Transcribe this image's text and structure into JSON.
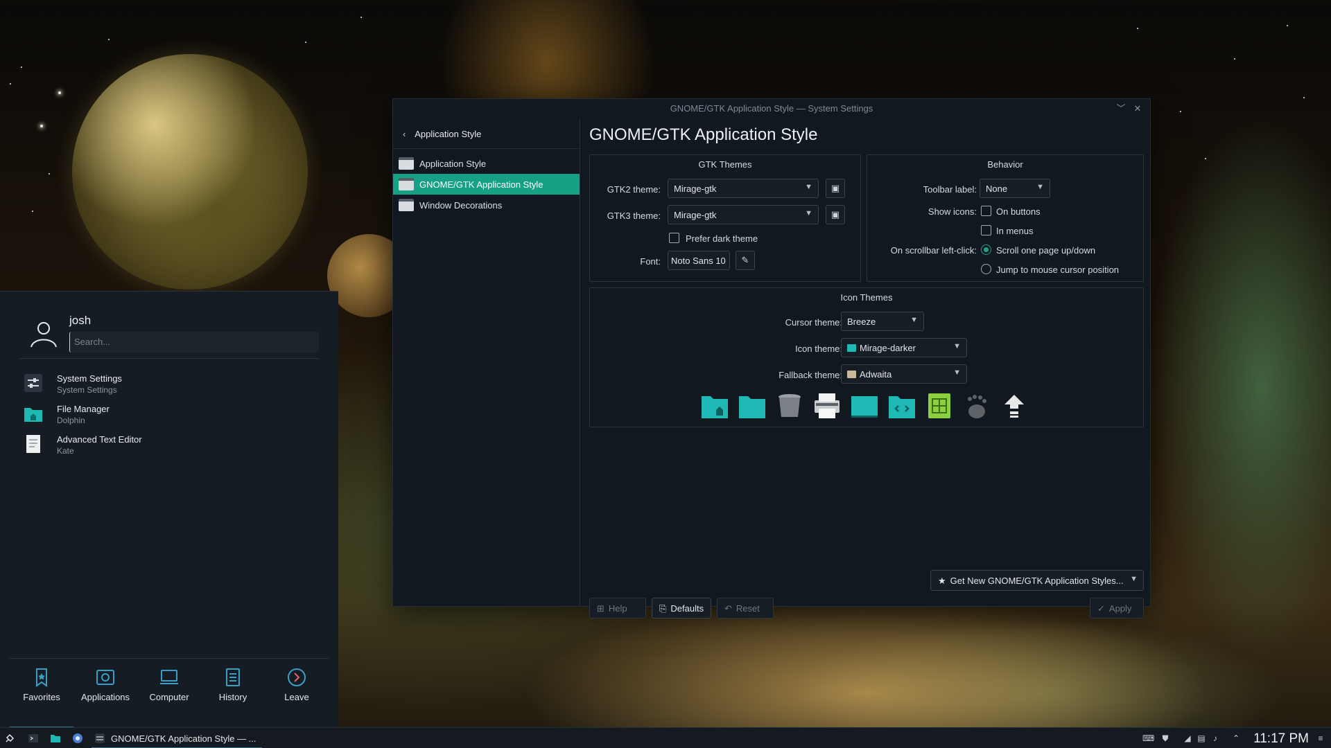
{
  "launcher": {
    "user_name": "josh",
    "search_placeholder": "Search...",
    "favorites": [
      {
        "name": "System Settings",
        "desc": "System Settings",
        "icon": "settings-icon"
      },
      {
        "name": "File Manager",
        "desc": "Dolphin",
        "icon": "folder-icon"
      },
      {
        "name": "Advanced Text Editor",
        "desc": "Kate",
        "icon": "text-editor-icon"
      }
    ],
    "tabs": [
      {
        "label": "Favorites",
        "icon": "bookmark-icon"
      },
      {
        "label": "Applications",
        "icon": "applications-icon"
      },
      {
        "label": "Computer",
        "icon": "computer-icon"
      },
      {
        "label": "History",
        "icon": "history-icon"
      },
      {
        "label": "Leave",
        "icon": "leave-icon"
      }
    ]
  },
  "window": {
    "title": "GNOME/GTK Application Style — System Settings",
    "sidebar": {
      "back_label": "Application Style",
      "items": [
        {
          "label": "Application Style"
        },
        {
          "label": "GNOME/GTK Application Style"
        },
        {
          "label": "Window Decorations"
        }
      ]
    },
    "page_title": "GNOME/GTK Application Style",
    "gtk_themes": {
      "title": "GTK Themes",
      "gtk2_label": "GTK2 theme:",
      "gtk2_value": "Mirage-gtk",
      "gtk3_label": "GTK3 theme:",
      "gtk3_value": "Mirage-gtk",
      "prefer_dark_label": "Prefer dark theme",
      "font_label": "Font:",
      "font_value": "Noto Sans 10"
    },
    "behavior": {
      "title": "Behavior",
      "toolbar_label": "Toolbar label:",
      "toolbar_value": "None",
      "show_icons_label": "Show icons:",
      "on_buttons": "On buttons",
      "in_menus": "In menus",
      "scrollbar_label": "On scrollbar left-click:",
      "scroll_page": "Scroll one page up/down",
      "jump_cursor": "Jump to mouse cursor position"
    },
    "icon_themes": {
      "title": "Icon Themes",
      "cursor_label": "Cursor theme:",
      "cursor_value": "Breeze",
      "icon_label": "Icon theme:",
      "icon_value": "Mirage-darker",
      "fallback_label": "Fallback theme:",
      "fallback_value": "Adwaita"
    },
    "get_new_label": "Get New GNOME/GTK Application Styles...",
    "buttons": {
      "help": "Help",
      "defaults": "Defaults",
      "reset": "Reset",
      "apply": "Apply"
    }
  },
  "taskbar": {
    "task_label": "GNOME/GTK Application Style — ...",
    "clock": "11:17 PM"
  },
  "colors": {
    "accent": "#16a085",
    "folder": "#1fb9b5"
  }
}
